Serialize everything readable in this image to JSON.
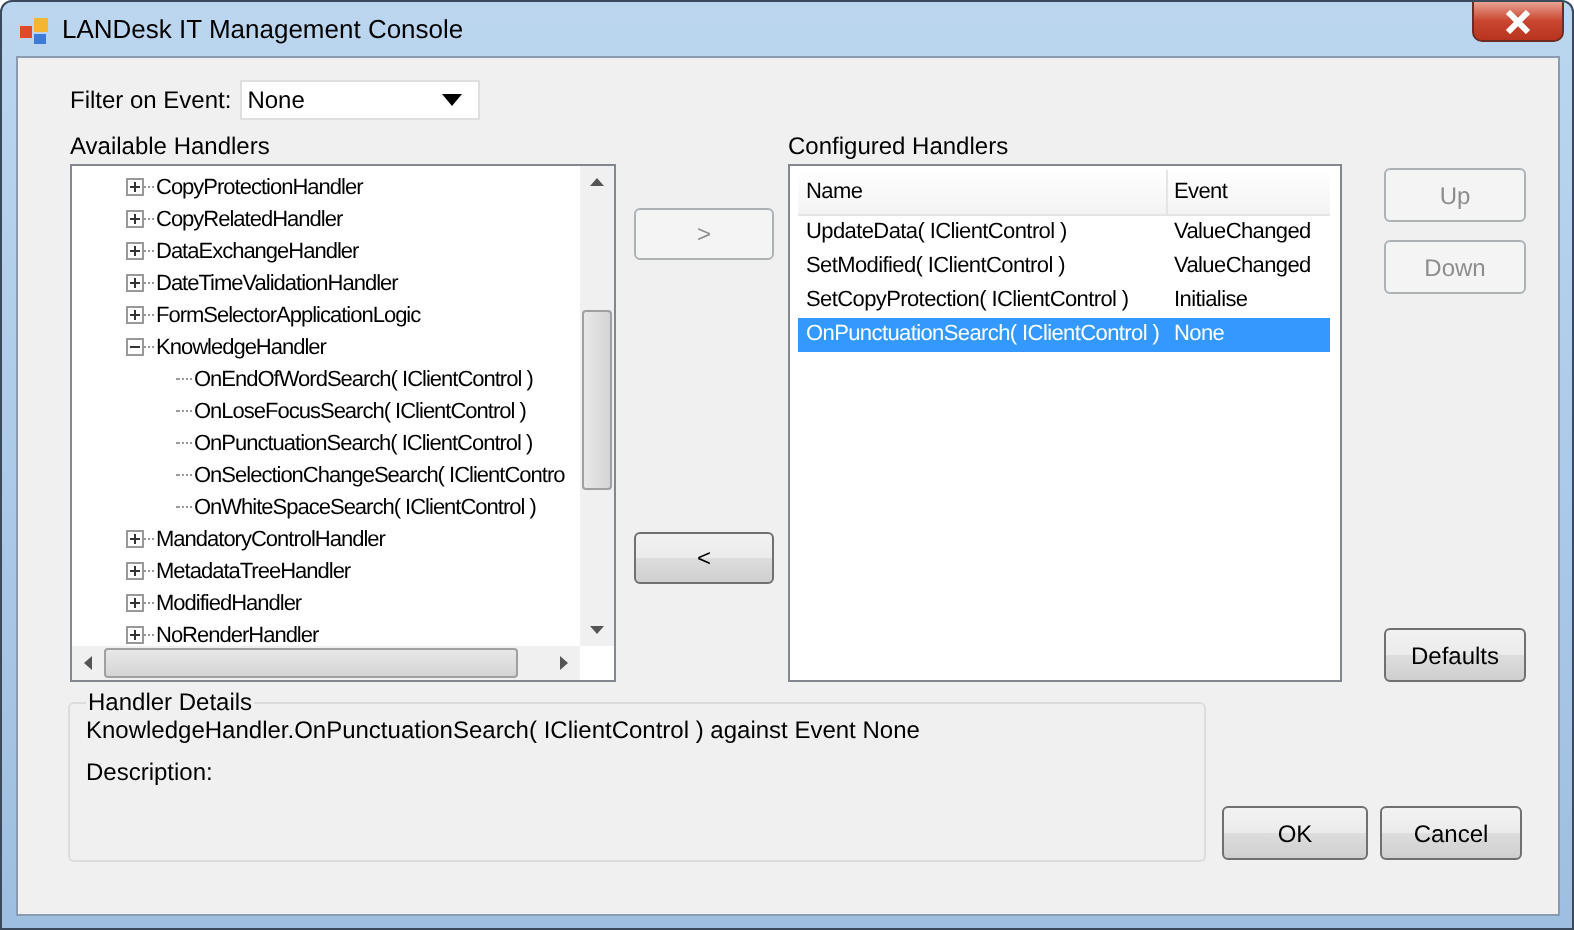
{
  "window": {
    "title": "LANDesk IT Management Console"
  },
  "filter": {
    "label": "Filter on Event:",
    "value": "None"
  },
  "available": {
    "label": "Available Handlers",
    "items": [
      {
        "label": "CopyProtectionHandler",
        "expanded": false
      },
      {
        "label": "CopyRelatedHandler",
        "expanded": false
      },
      {
        "label": "DataExchangeHandler",
        "expanded": false
      },
      {
        "label": "DateTimeValidationHandler",
        "expanded": false
      },
      {
        "label": "FormSelectorApplicationLogic",
        "expanded": false
      },
      {
        "label": "KnowledgeHandler",
        "expanded": true,
        "children": [
          {
            "label": "OnEndOfWordSearch( IClientControl )"
          },
          {
            "label": "OnLoseFocusSearch( IClientControl )"
          },
          {
            "label": "OnPunctuationSearch( IClientControl )"
          },
          {
            "label": "OnSelectionChangeSearch( IClientContro"
          },
          {
            "label": "OnWhiteSpaceSearch( IClientControl )"
          }
        ]
      },
      {
        "label": "MandatoryControlHandler",
        "expanded": false
      },
      {
        "label": "MetadataTreeHandler",
        "expanded": false
      },
      {
        "label": "ModifiedHandler",
        "expanded": false
      },
      {
        "label": "NoRenderHandler",
        "expanded": false
      }
    ]
  },
  "add_button": {
    "label": ">",
    "disabled": true
  },
  "remove_button": {
    "label": "<",
    "disabled": false
  },
  "configured": {
    "label": "Configured Handlers",
    "columns": [
      "Name",
      "Event"
    ],
    "rows": [
      {
        "name": "UpdateData( IClientControl )",
        "event": "ValueChanged",
        "selected": false
      },
      {
        "name": "SetModified( IClientControl )",
        "event": "ValueChanged",
        "selected": false
      },
      {
        "name": "SetCopyProtection( IClientControl )",
        "event": "Initialise",
        "selected": false
      },
      {
        "name": "OnPunctuationSearch( IClientControl )",
        "event": "None",
        "selected": true
      }
    ]
  },
  "up_button": {
    "label": "Up",
    "disabled": true
  },
  "down_button": {
    "label": "Down",
    "disabled": true
  },
  "defaults_button": {
    "label": "Defaults",
    "disabled": false
  },
  "details": {
    "legend": "Handler Details",
    "summary": "KnowledgeHandler.OnPunctuationSearch( IClientControl ) against Event None",
    "description_label": "Description:"
  },
  "ok_button": {
    "label": "OK",
    "disabled": false
  },
  "cancel_button": {
    "label": "Cancel",
    "disabled": false
  }
}
